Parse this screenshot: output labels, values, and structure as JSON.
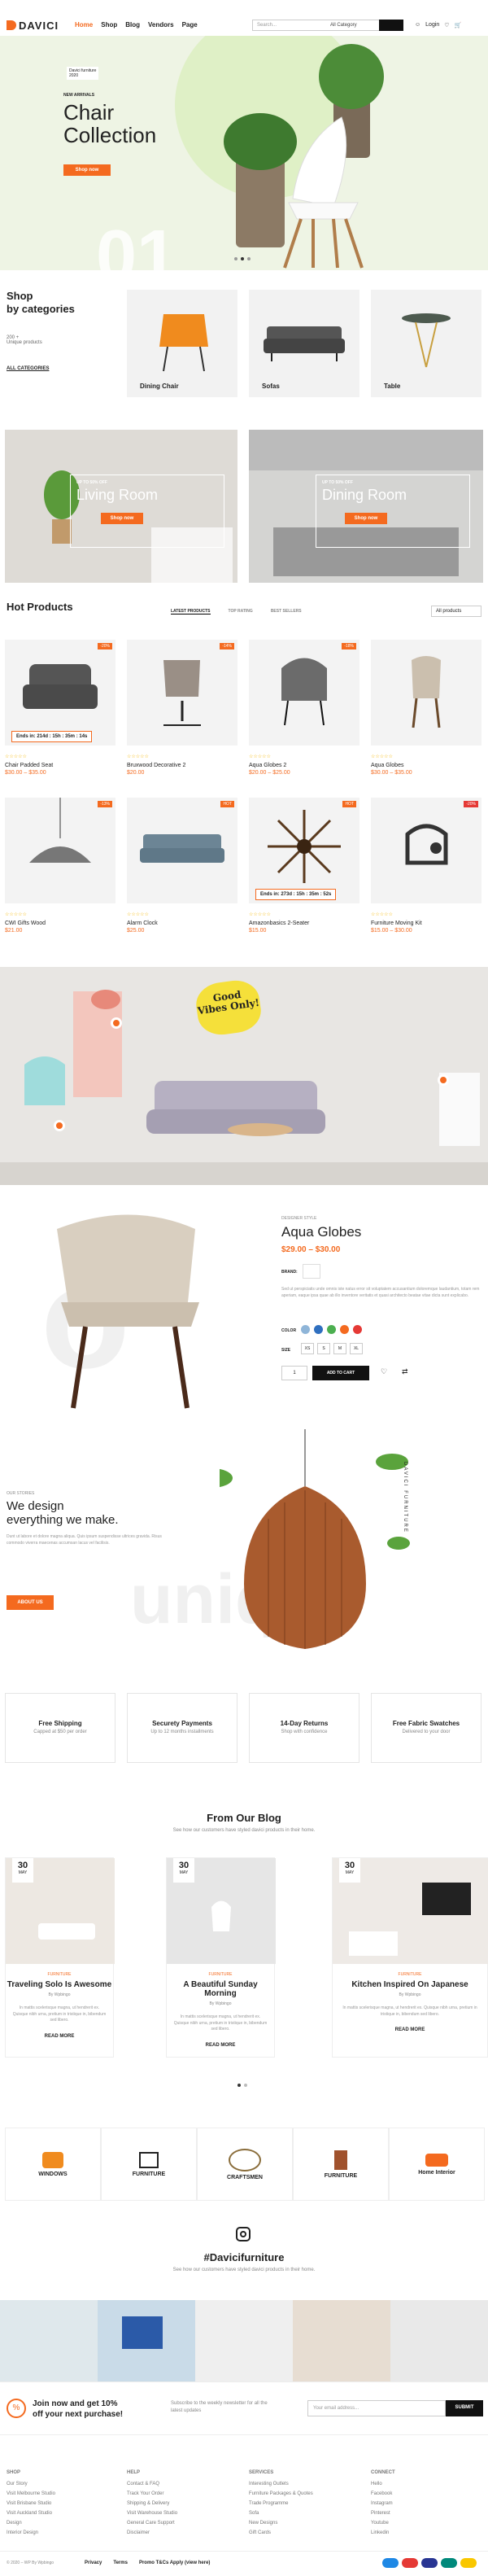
{
  "header": {
    "logo": "DAVICI",
    "nav": [
      "Home",
      "Shop",
      "Blog",
      "Vendors",
      "Page"
    ],
    "search_placeholder": "Search...",
    "search_category": "All Category",
    "login": "Login",
    "cart_count": "0"
  },
  "hero": {
    "tag1": "Davici furniture",
    "tag2": "2020",
    "kicker": "NEW ARRIVALS",
    "title1": "Chair",
    "title2": "Collection",
    "button": "Shop now",
    "number": "01"
  },
  "categories": {
    "title1": "Shop",
    "title2": "by categories",
    "count": "200 +",
    "count_label": "Unique products",
    "all": "ALL CATEGORIES",
    "items": [
      "Dining Chair",
      "Sofas",
      "Table"
    ]
  },
  "banners": [
    {
      "kicker": "UP TO 50% OFF",
      "title": "Living Room",
      "button": "Shop now"
    },
    {
      "kicker": "UP TO 50% OFF",
      "title": "Dining Room",
      "button": "Shop now"
    }
  ],
  "hot": {
    "title": "Hot Products",
    "tabs": [
      "LATEST PRODUCTS",
      "TOP RATING",
      "BEST SELLERS"
    ],
    "filter": "All products"
  },
  "products": [
    {
      "name": "Chair Padded Seat",
      "price": "$30.00 – $35.00",
      "badge": "-20%",
      "timer": "Ends in: 214d : 15h : 35m : 14s"
    },
    {
      "name": "Bruxwood Decorative 2",
      "price": "$20.00",
      "badge": "-14%"
    },
    {
      "name": "Aqua Globes 2",
      "price": "$20.00 – $25.00",
      "badge": "-18%"
    },
    {
      "name": "Aqua Globes",
      "price": "$30.00 – $35.00",
      "badge": ""
    },
    {
      "name": "CWI Gifts Wood",
      "price": "$21.00",
      "badge": "-13%"
    },
    {
      "name": "Alarm Clock",
      "price": "$25.00",
      "badge": "HOT"
    },
    {
      "name": "Amazonbasics 2-Seater",
      "price": "$15.00",
      "badge": "HOT",
      "timer": "Ends in: 273d : 15h : 35m : 52s"
    },
    {
      "name": "Furniture Moving Kit",
      "price": "$15.00 – $30.00",
      "badge": "-20%"
    }
  ],
  "lookbook": {
    "sticker1": "Good",
    "sticker2": "Vibes",
    "sticker3": "Only!"
  },
  "featured": {
    "kicker": "DESIGNER STYLE",
    "title": "Aqua Globes",
    "price": "$29.00 – $30.00",
    "brand_label": "BRAND:",
    "desc": "Sed ut perspiciatis unde omnis iste natus error sit voluptatem accusantium doloremque laudantium, totam rem aperiam, eaque ipsa quae ab illo inventore veritatis et quasi architecto beatae vitae dicta sunt explicabo.",
    "color_label": "COLOR",
    "size_label": "SIZE",
    "sizes": [
      "XS",
      "S",
      "M",
      "XL"
    ],
    "qty": "1",
    "add": "ADD TO CART",
    "colors": [
      "#8fb5d8",
      "#2f6fbf",
      "#4caf50",
      "#f46a1f",
      "#e53935"
    ]
  },
  "story": {
    "kicker": "OUR STORIES",
    "title1": "We design",
    "title2": "everything we make.",
    "desc": "Dunt ut labore et dolore magna aliqua. Quis ipsum suspendisse ultrices gravida. Risus commodo viverra maecenas accumsan lacus vel facilisis.",
    "button": "ABOUT US",
    "watermark": "unique",
    "vertical": "DAVICI FURNITURE"
  },
  "features": [
    {
      "title": "Free Shipping",
      "sub": "Capped at $50 per order"
    },
    {
      "title": "Securety Payments",
      "sub": "Up to 12 months installments"
    },
    {
      "title": "14-Day Returns",
      "sub": "Shop with confidence"
    },
    {
      "title": "Free Fabric Swatches",
      "sub": "Delivered to your door"
    }
  ],
  "blog": {
    "title": "From Our Blog",
    "sub": "See how our customers have styled davici products in their home.",
    "posts": [
      {
        "day": "30",
        "month": "MAY",
        "cat": "FURNITURE",
        "title": "Traveling Solo Is Awesome",
        "by": "By Wpbingo",
        "excerpt": "In mattis scelerisque magna, ut hendrerit ex. Quisque nibh urna, pretium in tristique in, bibendum sed libero.",
        "more": "READ MORE"
      },
      {
        "day": "30",
        "month": "MAY",
        "cat": "FURNITURE",
        "title": "A Beautiful Sunday Morning",
        "by": "By Wpbingo",
        "excerpt": "In mattis scelerisque magna, ut hendrerit ex. Quisque nibh urna, pretium in tristique in, bibendum sed libero.",
        "more": "READ MORE"
      },
      {
        "day": "30",
        "month": "MAY",
        "cat": "FURNITURE",
        "title": "Kitchen Inspired On Japanese",
        "by": "By Wpbingo",
        "excerpt": "In mattis scelerisque magna, ut hendrerit ex. Quisque nibh urna, pretium in tristique in, bibendum sed libero.",
        "more": "READ MORE"
      }
    ]
  },
  "brands": [
    "WINDOWS",
    "FURNITURE",
    "CRAFTSMEN",
    "FURNITURE",
    "Home Interior"
  ],
  "instagram": {
    "title": "#Davicifurniture",
    "sub": "See how our customers have styled davici products in their home."
  },
  "newsletter": {
    "title1": "Join now and get 10%",
    "title2": "off your next purchase!",
    "desc": "Subscribe to the weekly newsletter for all the latest updates",
    "placeholder": "Your email address...",
    "button": "SUBMIT"
  },
  "footer": {
    "cols": [
      {
        "h": "SHOP",
        "items": [
          "Our Story",
          "Visit Melbourne Studio",
          "Visit Brisbane Studio",
          "Visit Auckland Studio",
          "Design",
          "Interior Design"
        ]
      },
      {
        "h": "HELP",
        "items": [
          "Contact & FAQ",
          "Track Your Order",
          "Shipping & Delivery",
          "Visit Warehouse Studio",
          "General Care Support",
          "Disclaimer"
        ]
      },
      {
        "h": "SERVICES",
        "items": [
          "Interesting Outlets",
          "Furniture Packages & Quotes",
          "Trade Programme",
          "Sofa",
          "New Designs",
          "Gift Cards"
        ]
      },
      {
        "h": "CONNECT",
        "items": [
          "Hello",
          "Facebook",
          "Instagram",
          "Pinterest",
          "Youtube",
          "Linkedin"
        ]
      }
    ],
    "copyright": "© 2020 – WP By Wpbingo",
    "links": [
      "Privacy",
      "Terms",
      "Promo T&Cs Apply (view here)"
    ]
  }
}
